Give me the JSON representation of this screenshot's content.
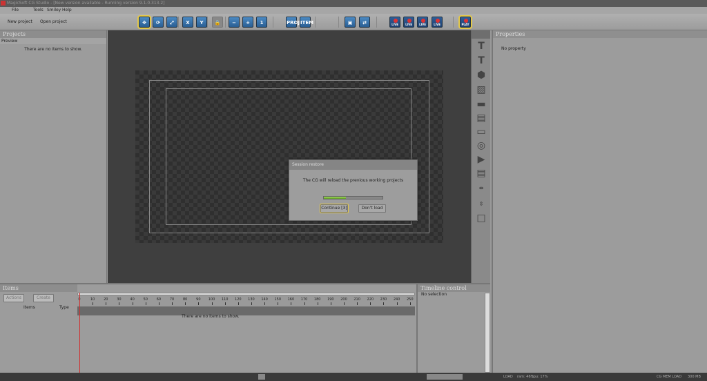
{
  "window": {
    "title": "MagicSoft CG Studio - [New version available - Running  version 9.1.0.313.2]"
  },
  "menu": [
    "File",
    "Tools",
    "Smiley",
    "Help"
  ],
  "toolbar": {
    "new_project": "New project",
    "open_project": "Open project",
    "buttons": [
      {
        "icon": "move-icon",
        "label": "",
        "selected": true
      },
      {
        "icon": "rotate-icon",
        "label": ""
      },
      {
        "icon": "scale-icon",
        "label": ""
      },
      {
        "icon": "x-axis-icon",
        "label": "X"
      },
      {
        "icon": "y-axis-icon",
        "label": "Y"
      },
      {
        "icon": "lock-icon",
        "label": ""
      },
      {
        "icon": "zoom-out-icon",
        "label": ""
      },
      {
        "icon": "zoom-in-icon",
        "label": ""
      },
      {
        "icon": "zoom-reset-icon",
        "label": "1"
      },
      {
        "icon": "project-select-icon",
        "label": "PROJ"
      },
      {
        "icon": "item-select-icon",
        "label": "ITEM"
      },
      {
        "icon": "package-icon",
        "label": ""
      },
      {
        "icon": "refresh-icon",
        "label": ""
      },
      {
        "icon": "live-icon",
        "label": "LIVE"
      },
      {
        "icon": "live-icon",
        "label": "LIVE"
      },
      {
        "icon": "live-icon",
        "label": "LIVE"
      },
      {
        "icon": "live-icon",
        "label": "LIVE"
      },
      {
        "icon": "play-icon",
        "label": "PLAY",
        "selected": true
      }
    ]
  },
  "projects": {
    "title": "Projects",
    "column": "Preview",
    "empty": "There are no items to show."
  },
  "properties": {
    "title": "Properties",
    "empty": "No property"
  },
  "dialog": {
    "title": "Session restore",
    "message": "The CG will reload the previous working projects",
    "progress": 0.38,
    "continue": "Continue [3]",
    "dont_load": "Don't load"
  },
  "items": {
    "title": "Items",
    "actions": "Actions",
    "create": "Create",
    "col_items": "Items",
    "col_type": "Type",
    "empty": "There are no items to show.",
    "ticks": [
      "0",
      "10",
      "20",
      "30",
      "40",
      "50",
      "60",
      "70",
      "80",
      "90",
      "100",
      "110",
      "120",
      "130",
      "140",
      "150",
      "160",
      "170",
      "180",
      "190",
      "200",
      "210",
      "220",
      "230",
      "240",
      "250"
    ]
  },
  "timeline_control": {
    "title": "Timeline control",
    "empty": "No selection"
  },
  "status": {
    "load": "LOAD",
    "ram": "ram: 46%",
    "cpu": "cpu: 17%",
    "cg_mem": "CG MEM LOAD",
    "mem_value": "300 MB"
  },
  "colors": {
    "accent": "#e3c84a",
    "progress": "#7cc23a",
    "playhead": "#d03030"
  }
}
